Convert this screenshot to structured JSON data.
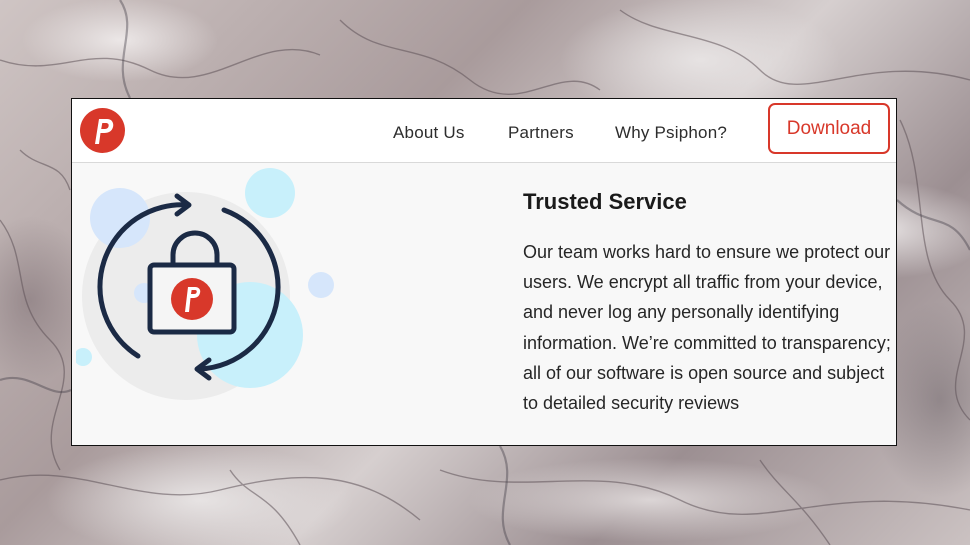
{
  "navbar": {
    "logo_letter": "P",
    "links": [
      "About Us",
      "Partners",
      "Why Psiphon?"
    ],
    "download_label": "Download"
  },
  "feature": {
    "title": "Trusted Service",
    "body": "Our team works hard to ensure we protect our users. We encrypt all traffic from your device, and never log any personally identifying information. We’re committed to transparency; all of our software is open source and subject to detailed security reviews"
  },
  "colors": {
    "brand_red": "#d8382a",
    "navy": "#1b2a45",
    "light_blue": "#c8f0fb",
    "pale_blue": "#d6e6fb"
  }
}
